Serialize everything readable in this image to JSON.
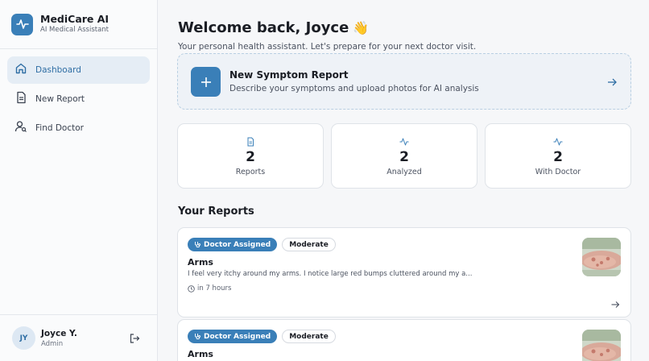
{
  "app": {
    "name": "MediCare AI",
    "subtitle": "AI Medical Assistant",
    "accent": "#3a7fb8"
  },
  "sidebar": {
    "items": [
      {
        "label": "Dashboard",
        "icon": "home-icon",
        "active": true
      },
      {
        "label": "New Report",
        "icon": "document-icon",
        "active": false
      },
      {
        "label": "Find Doctor",
        "icon": "user-search-icon",
        "active": false
      }
    ]
  },
  "user": {
    "initials": "JY",
    "name": "Joyce Y.",
    "role": "Admin"
  },
  "main": {
    "welcome": "Welcome back, Joyce",
    "wave": "👋",
    "subtitle": "Your personal health assistant. Let's prepare for your next doctor visit.",
    "new_report": {
      "title": "New Symptom Report",
      "description": "Describe your symptoms and upload photos for AI analysis"
    },
    "stats": [
      {
        "value": "2",
        "label": "Reports",
        "icon": "document-icon"
      },
      {
        "value": "2",
        "label": "Analyzed",
        "icon": "activity-icon"
      },
      {
        "value": "2",
        "label": "With Doctor",
        "icon": "activity-icon"
      }
    ],
    "reports_title": "Your Reports",
    "reports": [
      {
        "status": "Doctor Assigned",
        "severity": "Moderate",
        "title": "Arms",
        "description": "I feel very itchy around my arms. I notice large red bumps cluttered around my a...",
        "time": "in 7 hours"
      },
      {
        "status": "Doctor Assigned",
        "severity": "Moderate",
        "title": "Arms",
        "description": "",
        "time": ""
      }
    ]
  }
}
